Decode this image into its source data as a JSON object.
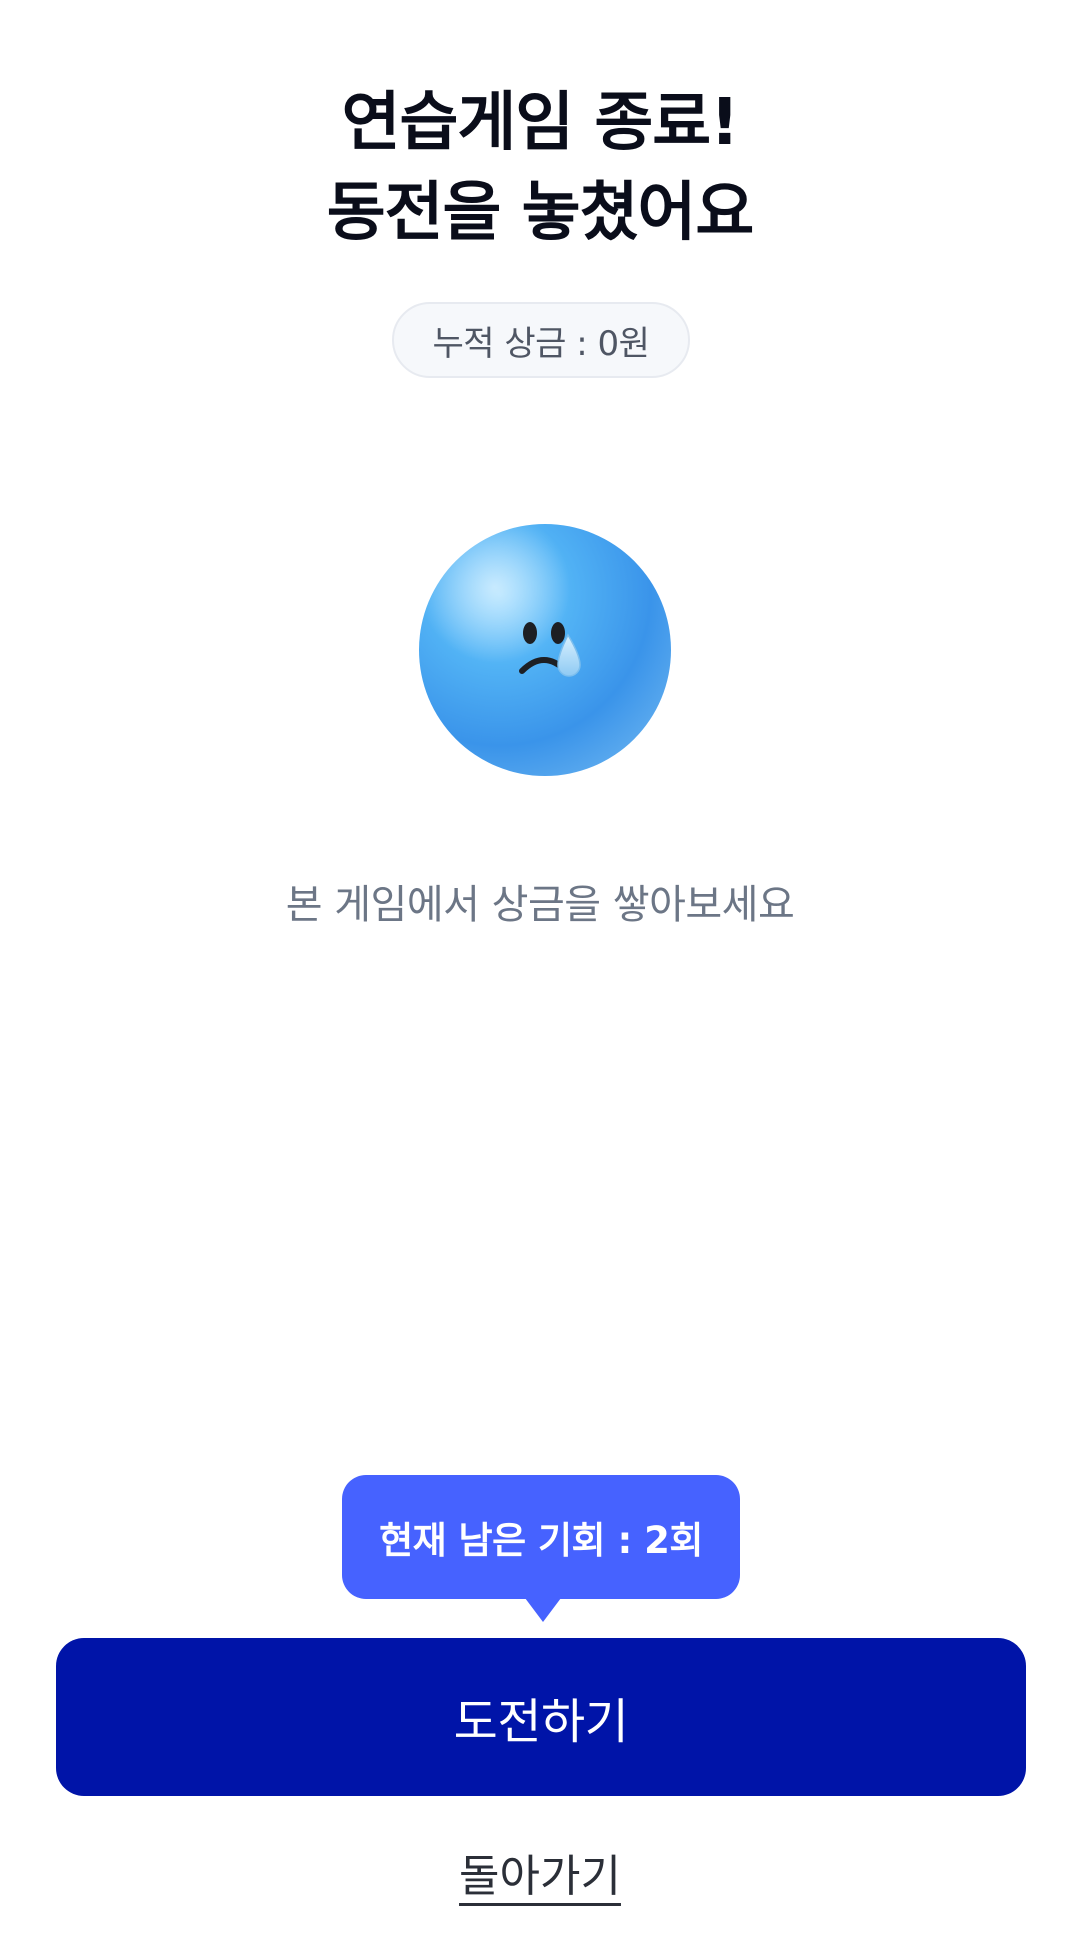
{
  "header": {
    "title_line1": "연습게임 종료!",
    "title_line2": "동전을 놓쳤어요"
  },
  "prize": {
    "label": "누적 상금 : 0원"
  },
  "emoji": {
    "icon": "sad-crying-face-icon",
    "color": "#4aa8f0"
  },
  "message": {
    "text": "본 게임에서 상금을 쌓아보세요"
  },
  "tooltip": {
    "text": "현재 남은 기회 : 2회",
    "color": "#4662ff"
  },
  "actions": {
    "challenge_label": "도전하기",
    "challenge_color": "#0014a8",
    "back_label": "돌아가기"
  }
}
